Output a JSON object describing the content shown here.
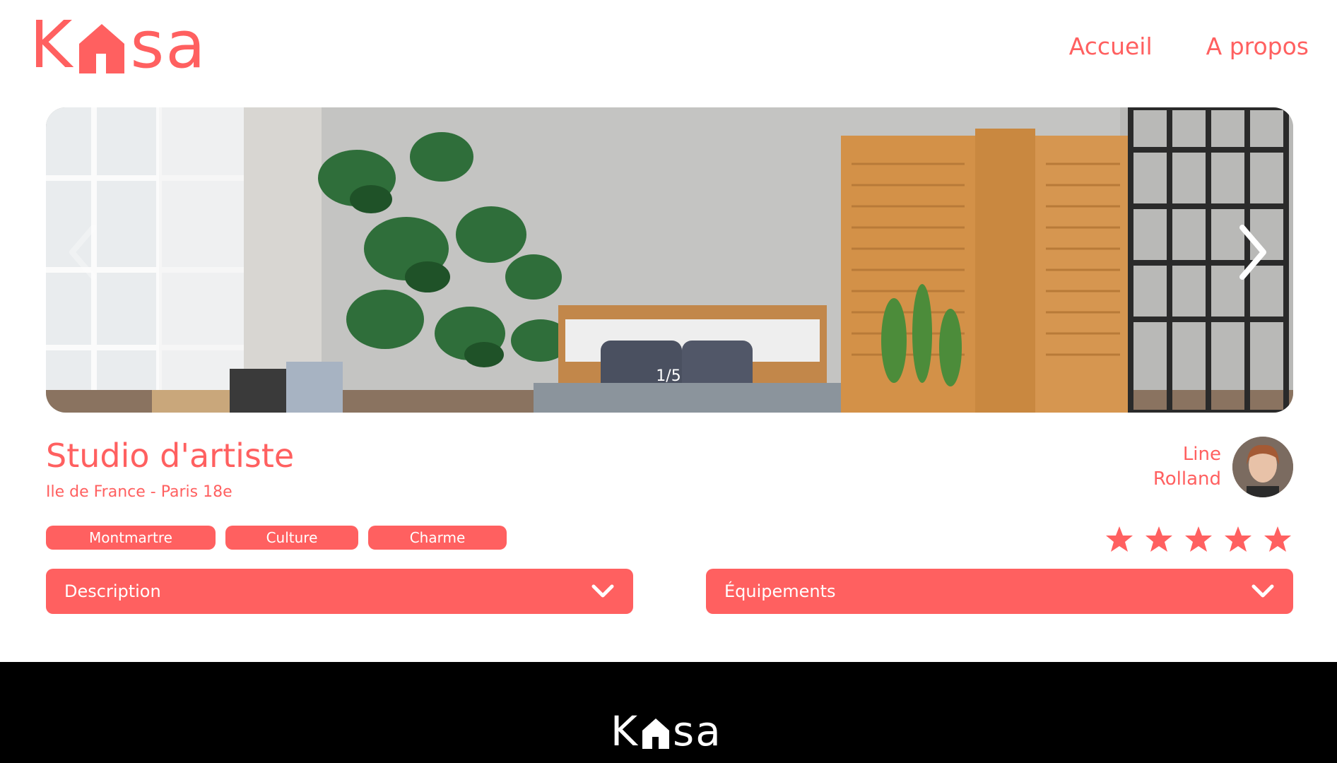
{
  "header": {
    "logo": {
      "k": "K",
      "rest": "sa",
      "icon": "house-icon"
    },
    "nav": [
      {
        "label": "Accueil"
      },
      {
        "label": "A propos"
      }
    ]
  },
  "carousel": {
    "counter": "1/5",
    "prev_icon": "chevron-left-icon",
    "next_icon": "chevron-right-icon"
  },
  "listing": {
    "title": "Studio d'artiste",
    "location": "Ile de France - Paris 18e",
    "host": {
      "first": "Line",
      "last": "Rolland"
    },
    "tags": [
      "Montmartre",
      "Culture",
      "Charme"
    ],
    "rating": 5,
    "rating_max": 5
  },
  "collapses": [
    {
      "label": "Description",
      "icon": "chevron-down-icon"
    },
    {
      "label": "Équipements",
      "icon": "chevron-down-icon"
    }
  ],
  "footer": {
    "logo": {
      "k": "K",
      "rest": "sa",
      "icon": "house-icon"
    }
  },
  "colors": {
    "accent": "#FF6060",
    "footer_bg": "#000000",
    "text_on_accent": "#FFFFFF"
  }
}
